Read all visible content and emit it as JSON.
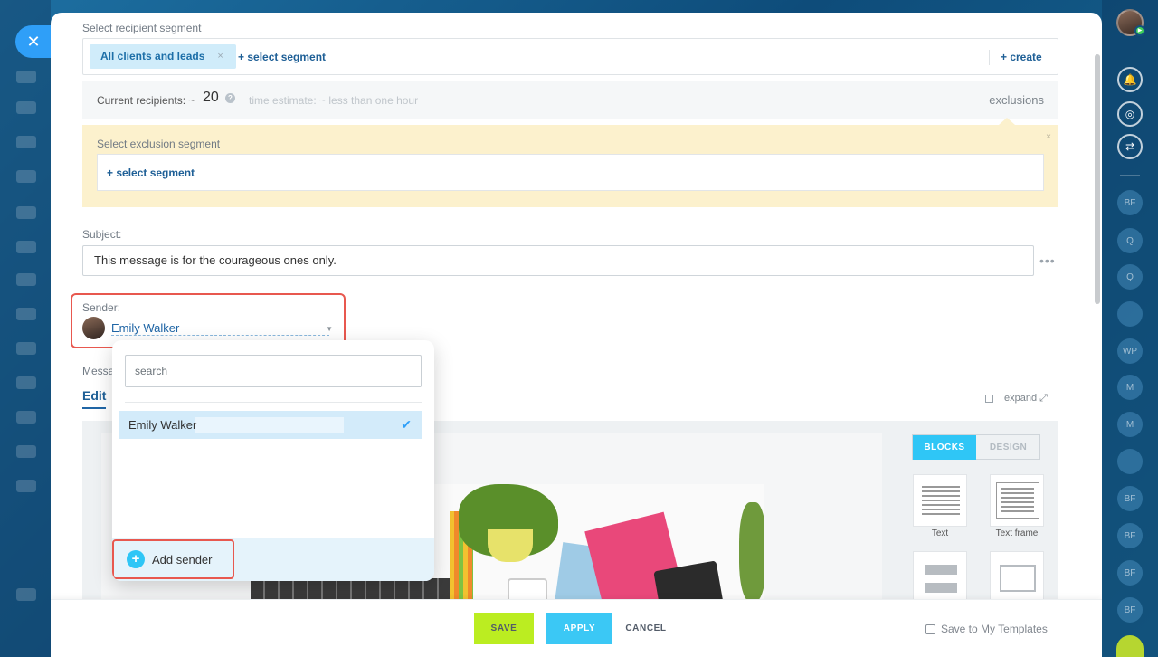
{
  "close": {
    "icon": "close-icon",
    "label": "✕"
  },
  "segment": {
    "label": "Select recipient segment",
    "chip": "All clients and leads",
    "chip_remove": "×",
    "select_link": "+ select segment",
    "create_link": "+ create"
  },
  "recipients": {
    "label": "Current recipients: ~",
    "count": "20",
    "help": "?",
    "time_estimate": "time estimate: ~ less than one hour",
    "exclusions": "exclusions"
  },
  "exclusion": {
    "label": "Select exclusion segment",
    "close": "×",
    "select_link": "+ select segment"
  },
  "subject": {
    "label": "Subject:",
    "value": "This message is for the courageous ones only.",
    "more": "•••"
  },
  "sender": {
    "label": "Sender:",
    "name": "Emily Walker",
    "caret": "▼"
  },
  "message": {
    "label_partial": "Messa",
    "edit_tab": "Edit",
    "expand": "expand ⤢"
  },
  "dropdown": {
    "search_placeholder": "search",
    "items": [
      {
        "name": "Emily Walker",
        "selected": true
      }
    ],
    "check": "✔",
    "add_sender": "Add sender",
    "add_icon": "+"
  },
  "editor": {
    "tab_blocks": "BLOCKS",
    "tab_design": "DESIGN",
    "blocks": [
      {
        "caption": "Text",
        "icon": "text-block-icon"
      },
      {
        "caption": "Text frame",
        "icon": "text-frame-block-icon"
      },
      {
        "caption": "",
        "icon": "divider-block-icon"
      },
      {
        "caption": "",
        "icon": "image-block-icon"
      }
    ]
  },
  "footer": {
    "save": "SAVE",
    "apply": "APPLY",
    "cancel": "CANCEL",
    "save_template": "Save to My Templates"
  },
  "right_rail": {
    "bubbles": [
      "BF",
      "Q",
      "Q",
      "",
      "WP",
      "M",
      "M",
      "",
      "BF",
      "BF",
      "BF",
      "BF"
    ]
  },
  "colors": {
    "accent_blue": "#2fc6f6",
    "save_green": "#bbed21",
    "highlight_red": "#e8584f",
    "link_blue": "#1e5f96",
    "exclusion_bg": "#fcf1cd"
  }
}
